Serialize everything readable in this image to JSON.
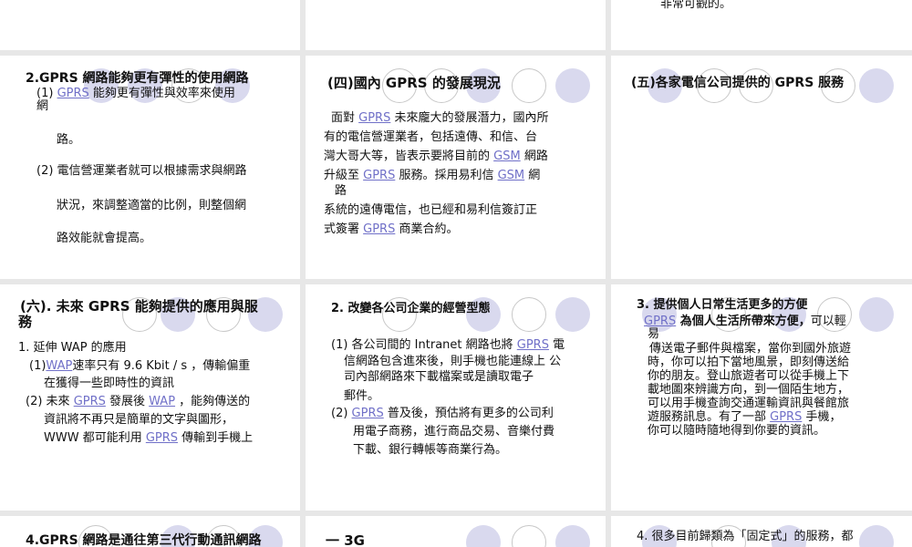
{
  "slides": {
    "s1": {
      "tail": "非常可觀的。"
    },
    "s2": {
      "title": "2.GPRS  網路能夠更有彈性的使用網路",
      "l1a": "(1)",
      "l1b": "GPRS",
      "l1c": "  能夠更有彈性與效率來使用",
      "l1d": "網",
      "l2": "路。",
      "l3": "(2) 電信營運業者就可以根據需求與網路",
      "l4": "狀況，來調整適當的比例，則整個網",
      "l5": "路效能就會提高。"
    },
    "s3": {
      "title": "(四)國內  GPRS  的發展現況",
      "p1a": "面對  ",
      "p1b": "GPRS",
      "p1c": "  未來龐大的發展潛力，國內所",
      "p2": "有的電信營運業者，包括遠傳、和信、台",
      "p3a": "灣大哥大等，皆表示要將目前的  ",
      "p3b": "GSM",
      "p3c": "  網路",
      "p4a": "升級至  ",
      "p4b": "GPRS",
      "p4c": "  服務。採用易利信  ",
      "p4d": "GSM",
      "p4e": "  網",
      "p4f": "路",
      "p5": "系統的遠傳電信，也已經和易利信簽訂正",
      "p6a": "式簽署  ",
      "p6b": "GPRS",
      "p6c": "  商業合約。"
    },
    "s4": {
      "title": "(五)各家電信公司提供的 GPRS 服務"
    },
    "s5": {
      "title1": "(六). 未來  GPRS  能夠提供的應用與服",
      "title2": "務",
      "l1": "1. 延伸  WAP  的應用",
      "l2a": "(1)",
      "l2b": "WAP",
      "l2c": "速率只有  9.6 Kbit / s  ，傳輸偏重",
      "l3": "在獲得一些即時性的資訊",
      "l4a": "(2) 未來  ",
      "l4b": "GPRS",
      "l4c": "  發展後 ",
      "l4d": "WAP",
      "l4e": "  ，能夠傳送的",
      "l5": "資訊將不再只是簡單的文字與圖形，",
      "l6a": "WWW 都可能利用  ",
      "l6b": "GPRS",
      "l6c": "  傳輸到手機上"
    },
    "s6": {
      "title": "2. 改變各公司企業的經營型態",
      "l1a": "(1) 各公司間的  Intranet  網路也將  ",
      "l1b": "GPRS",
      "l1c": "  電",
      "l2": "信網路包含進來後，則手機也能連線上  公",
      "l3": "司內部網路來下載檔案或是讀取電子",
      "l4": "郵件。",
      "l5a": "(2) ",
      "l5b": "GPRS",
      "l5c": "  普及後，預估將有更多的公司利",
      "l6": "用電子商務，進行商品交易、音樂付費",
      "l7": "下載、銀行轉帳等商業行為。"
    },
    "s7": {
      "title": "3. 提供個人日常生活更多的方便",
      "l1a": "GPRS",
      "l1b": "  為個人生活所帶來方便，",
      "l1c": "可以輕",
      "l1d": "易",
      "l2": "傳送電子郵件與檔案，當你到國外旅遊",
      "l3": "時，你可以拍下當地風景，即刻傳送給",
      "l4": "你的朋友。登山旅遊者可以從手機上下",
      "l5": "載地圖來辨識方向，到一個陌生地方，",
      "l6": "可以用手機查詢交通運輸資訊與餐館旅",
      "l7a": "遊服務訊息。有了一部  ",
      "l7b": "GPRS",
      "l7c": "  手機，",
      "l8": "你可以隨時隨地得到你要的資訊。"
    },
    "s8": {
      "title": "4.GPRS  網路是通往第三代行動通訊網路"
    },
    "s9": {
      "title": "一  3G"
    },
    "s10": {
      "title": "4. 很多目前歸類為「固定式」的服務，都"
    }
  },
  "colors": {
    "background": "#e7e7e7",
    "slide": "#ffffff",
    "circle_fill": "#d9d9ee",
    "link": "#7070c8"
  }
}
